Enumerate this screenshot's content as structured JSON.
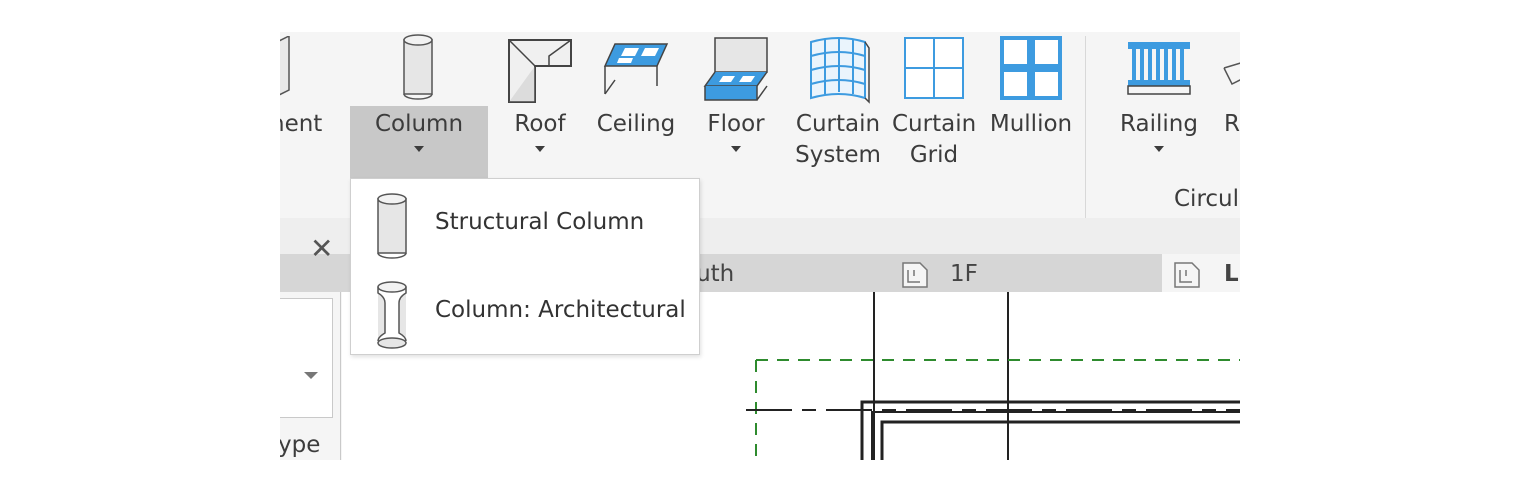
{
  "ribbon": {
    "partial_left_label": "nent",
    "column_button": "Column",
    "buttons": {
      "roof": "Roof",
      "ceiling": "Ceiling",
      "floor": "Floor",
      "curtain_system": [
        "Curtain",
        "System"
      ],
      "curtain_grid": [
        "Curtain",
        "Grid"
      ],
      "mullion": "Mullion",
      "railing": "Railing",
      "partial_right": "R"
    },
    "panel_label": "Circul"
  },
  "dropdown": {
    "items": [
      {
        "label": "Structural Column",
        "icon": "structural-column-icon"
      },
      {
        "label": "Column: Architectural",
        "icon": "architectural-column-icon"
      }
    ]
  },
  "view_tabs": {
    "tab_1": "outh",
    "tab_2": "1F",
    "tab_active_partial": "L"
  },
  "properties": {
    "type_partial": "ype"
  },
  "colors": {
    "accent_blue": "#3d9be0",
    "pressed_gray": "#c8c8c8",
    "dashed_green": "#2e8b2e"
  }
}
